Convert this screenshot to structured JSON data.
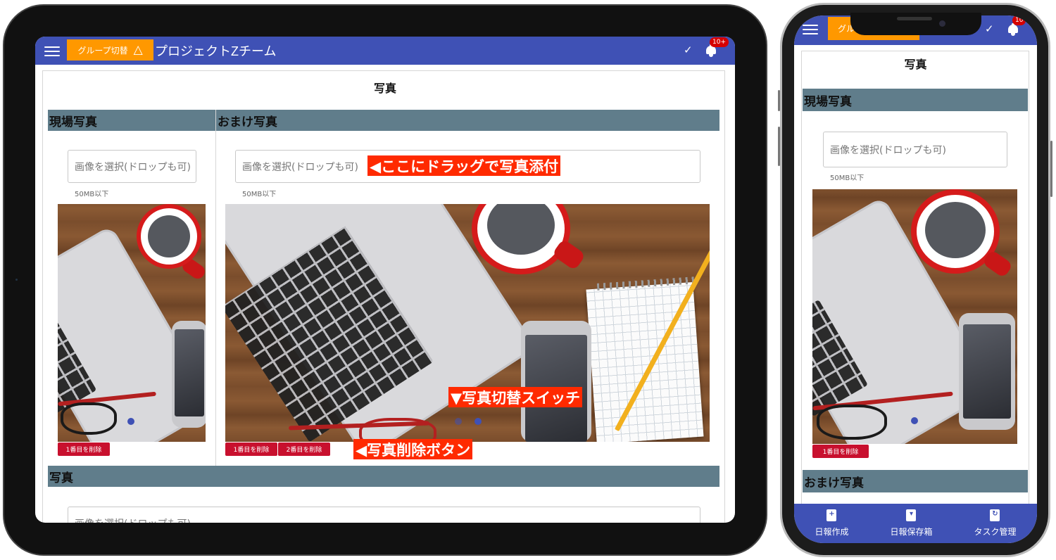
{
  "app": {
    "group_switch_label": "グループ切替",
    "team_title": "プロジェクトZチーム",
    "notification_badge": "10+",
    "notification_badge_phone": "10"
  },
  "page": {
    "title": "写真"
  },
  "sections": {
    "site_photos": "現場写真",
    "bonus_photos": "おまけ写真",
    "photos": "写真"
  },
  "file_input": {
    "placeholder": "画像を選択(ドロップも可)",
    "size_limit": "50MB以下"
  },
  "delete_buttons": {
    "first": "1番目を削除",
    "second": "2番目を削除"
  },
  "callouts": {
    "drag_hint": "◀ここにドラッグで写真添付",
    "switch_hint": "▼写真切替スイッチ",
    "delete_hint": "◀写真削除ボタン"
  },
  "bottom_nav": [
    {
      "label": "日報作成",
      "icon": "new-report-icon"
    },
    {
      "label": "日報保存箱",
      "icon": "archive-box-icon"
    },
    {
      "label": "タスク管理",
      "icon": "task-refresh-icon"
    }
  ],
  "colors": {
    "appbar": "#3f51b5",
    "group_button": "#ff9800",
    "section_header": "#607d8b",
    "delete_button": "#c8102e",
    "callout": "#ff2a00",
    "badge": "#d50000"
  }
}
